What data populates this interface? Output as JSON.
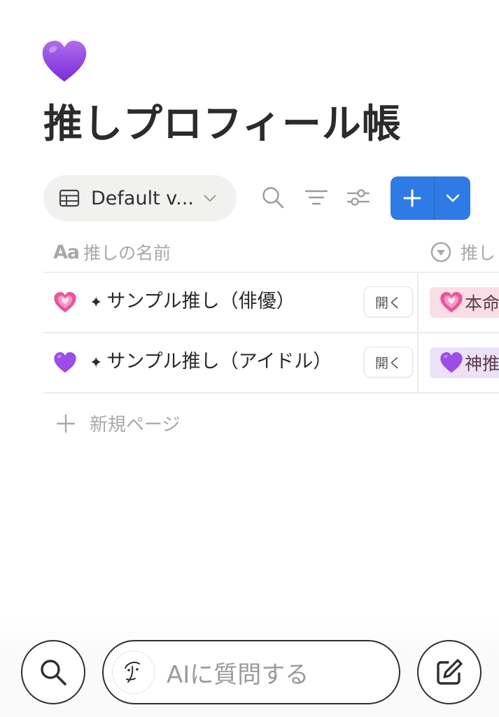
{
  "page": {
    "icon": "purple-heart-icon",
    "title": "推しプロフィール帳"
  },
  "toolbar": {
    "view_label": "Default v...",
    "icons": [
      "table-icon",
      "chevron-down-icon",
      "search-icon",
      "sort-icon",
      "filter-settings-icon"
    ],
    "new_button": {
      "icons": [
        "plus-icon",
        "chevron-down-icon"
      ],
      "color": "#2f7be5"
    }
  },
  "table": {
    "columns": [
      {
        "icon": "text-type-icon",
        "icon_text": "Aa",
        "label": "推しの名前"
      },
      {
        "icon": "select-type-icon",
        "label": "推し"
      }
    ],
    "rows": [
      {
        "emoji": "pink-heart-icon",
        "sparkle": "✦",
        "name": "サンプル推し（俳優）",
        "open_label": "開く",
        "tag": {
          "icon": "pink-heart-icon",
          "label": "本命",
          "bg": "#f9dfe5"
        }
      },
      {
        "emoji": "purple-heart-icon",
        "sparkle": "✦",
        "name": "サンプル推し（アイドル）",
        "open_label": "開く",
        "tag": {
          "icon": "purple-heart-icon",
          "label": "神推",
          "bg": "#ece2f8"
        }
      }
    ],
    "new_page_label": "新規ページ"
  },
  "bottom_bar": {
    "search_icon": "search-icon",
    "ai_placeholder": "AIに質問する",
    "ai_icon": "ai-face-icon",
    "compose_icon": "edit-icon"
  }
}
